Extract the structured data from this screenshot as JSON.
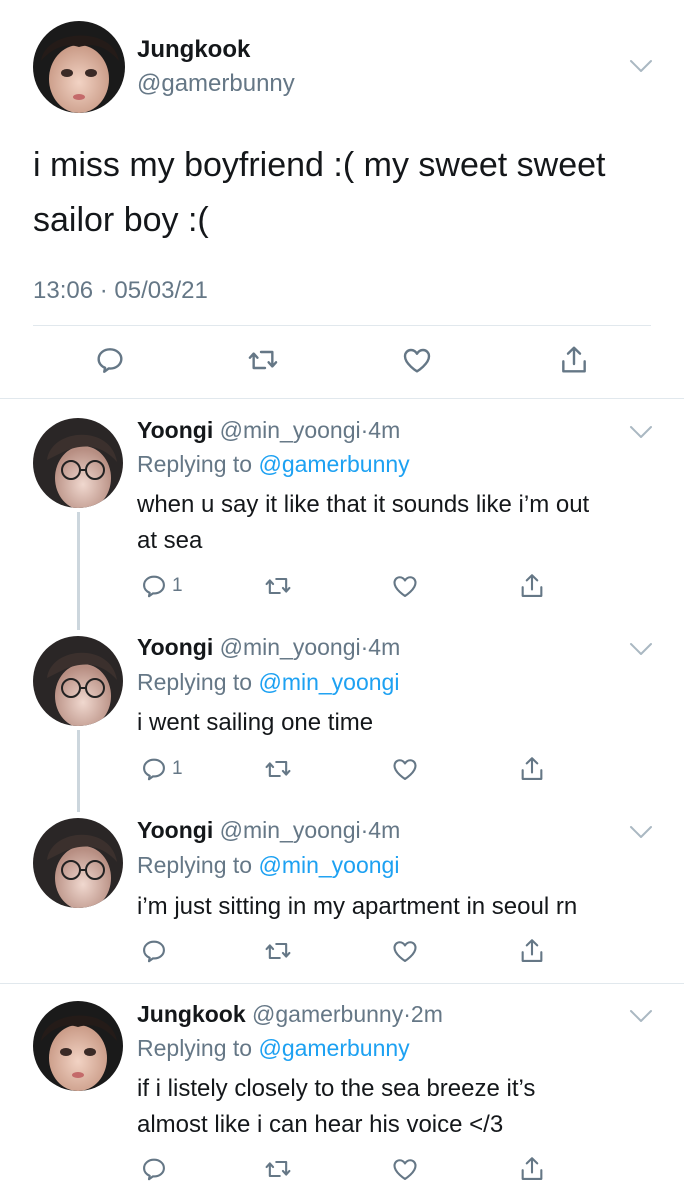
{
  "main_tweet": {
    "name": "Jungkook",
    "handle": "@gamerbunny",
    "text_line1": "i miss my boyfriend :( my sweet sweet",
    "text_line2": "sailor boy :(",
    "timestamp": "13:06 · 05/03/21"
  },
  "replies": [
    {
      "name": "Yoongi",
      "handle": "@min_yoongi",
      "sep": "·",
      "time": "4m",
      "replying_prefix": "Replying to",
      "replying_to": "@gamerbunny",
      "text_line1": "when u say it like that it sounds like i’m out",
      "text_line2": "at sea",
      "reply_count": "1"
    },
    {
      "name": "Yoongi",
      "handle": "@min_yoongi",
      "sep": "·",
      "time": "4m",
      "replying_prefix": "Replying to",
      "replying_to": "@min_yoongi",
      "text_line1": "i went sailing one time",
      "text_line2": "",
      "reply_count": "1"
    },
    {
      "name": "Yoongi",
      "handle": "@min_yoongi",
      "sep": "·",
      "time": "4m",
      "replying_prefix": "Replying to",
      "replying_to": "@min_yoongi",
      "text_line1": "i’m just sitting in my apartment in seoul rn",
      "text_line2": "",
      "reply_count": ""
    },
    {
      "name": "Jungkook",
      "handle": "@gamerbunny",
      "sep": "·",
      "time": "2m",
      "replying_prefix": "Replying to",
      "replying_to": "@gamerbunny",
      "text_line1": "if i listely closely to the sea breeze it’s",
      "text_line2": "almost like i can hear his voice </3",
      "reply_count": ""
    }
  ],
  "icons": {
    "reply": "reply-icon",
    "retweet": "retweet-icon",
    "like": "heart-icon",
    "share": "share-icon",
    "more": "chevron-down-icon"
  },
  "colors": {
    "accent": "#1da1f2",
    "secondary_text": "#657786",
    "divider": "#e1e8ed"
  }
}
